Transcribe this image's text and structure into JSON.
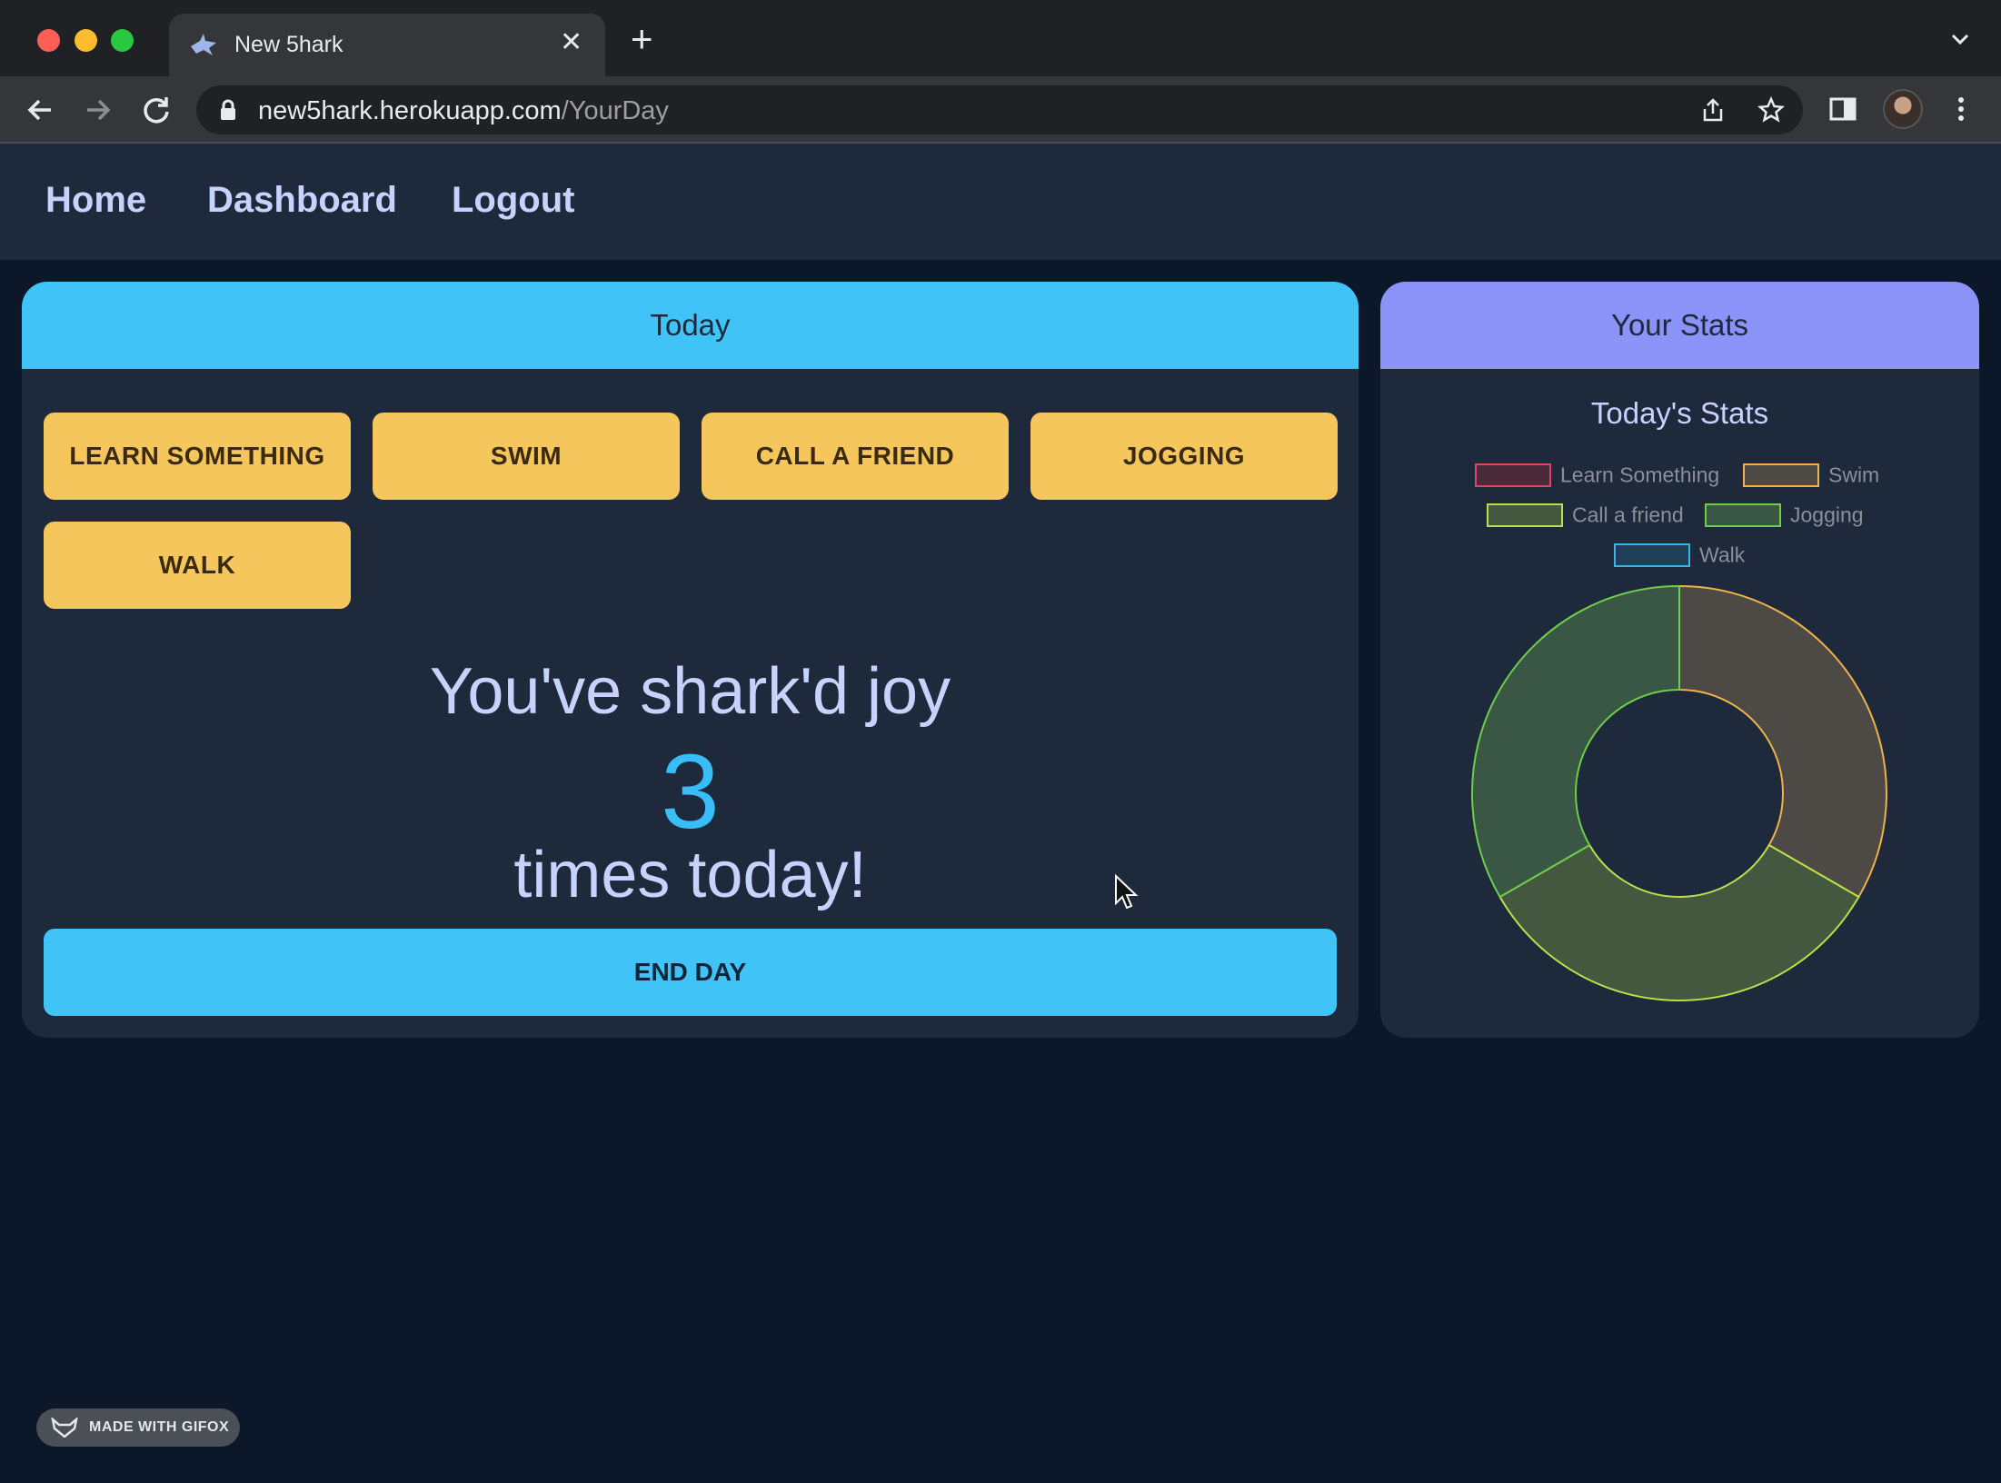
{
  "browser": {
    "tab_title": "New 5hark",
    "tab_close": "✕",
    "new_tab": "+",
    "url_host": "new5hark.herokuapp.com",
    "url_path": "/YourDay"
  },
  "nav": {
    "home": "Home",
    "dashboard": "Dashboard",
    "logout": "Logout"
  },
  "today": {
    "header": "Today",
    "activities": [
      "LEARN SOMETHING",
      "SWIM",
      "CALL A FRIEND",
      "JOGGING",
      "WALK"
    ],
    "joy_prefix": "You've shark'd joy",
    "joy_count": "3",
    "joy_suffix": "times today!",
    "end_day": "END DAY"
  },
  "stats": {
    "header": "Your Stats",
    "title": "Today's Stats"
  },
  "chart_data": {
    "type": "pie",
    "title": "Today's Stats",
    "legend_position": "top",
    "categories": [
      "Learn Something",
      "Swim",
      "Call a friend",
      "Jogging",
      "Walk"
    ],
    "values": [
      0,
      1,
      1,
      1,
      0
    ],
    "colors": {
      "border": [
        "#e0475c",
        "#f0b14a",
        "#b9e04a",
        "#6ccf4a",
        "#3bb3e3"
      ],
      "fill": [
        "#4a2a38",
        "#4d4a45",
        "#44573f",
        "#3a5645",
        "#1e3f55"
      ]
    }
  },
  "footer": {
    "gifox": "MADE WITH GIFOX"
  }
}
